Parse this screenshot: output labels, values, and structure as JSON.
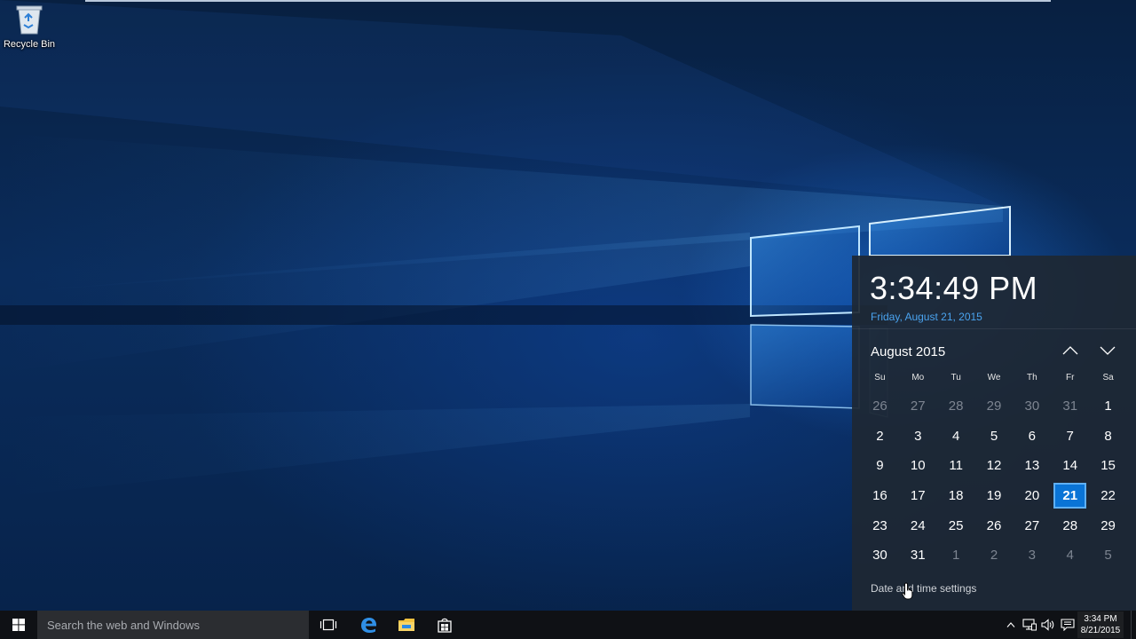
{
  "desktop": {
    "icons": [
      {
        "label": "Recycle Bin"
      }
    ]
  },
  "calendar_flyout": {
    "time": "3:34:49 PM",
    "full_date": "Friday, August 21, 2015",
    "month_title": "August 2015",
    "weekdays": [
      "Su",
      "Mo",
      "Tu",
      "We",
      "Th",
      "Fr",
      "Sa"
    ],
    "days": [
      {
        "d": "26",
        "current": false
      },
      {
        "d": "27",
        "current": false
      },
      {
        "d": "28",
        "current": false
      },
      {
        "d": "29",
        "current": false
      },
      {
        "d": "30",
        "current": false
      },
      {
        "d": "31",
        "current": false
      },
      {
        "d": "1",
        "current": true
      },
      {
        "d": "2",
        "current": true
      },
      {
        "d": "3",
        "current": true
      },
      {
        "d": "4",
        "current": true
      },
      {
        "d": "5",
        "current": true
      },
      {
        "d": "6",
        "current": true
      },
      {
        "d": "7",
        "current": true
      },
      {
        "d": "8",
        "current": true
      },
      {
        "d": "9",
        "current": true
      },
      {
        "d": "10",
        "current": true
      },
      {
        "d": "11",
        "current": true
      },
      {
        "d": "12",
        "current": true
      },
      {
        "d": "13",
        "current": true
      },
      {
        "d": "14",
        "current": true
      },
      {
        "d": "15",
        "current": true
      },
      {
        "d": "16",
        "current": true
      },
      {
        "d": "17",
        "current": true
      },
      {
        "d": "18",
        "current": true
      },
      {
        "d": "19",
        "current": true
      },
      {
        "d": "20",
        "current": true
      },
      {
        "d": "21",
        "current": true,
        "today": true
      },
      {
        "d": "22",
        "current": true
      },
      {
        "d": "23",
        "current": true
      },
      {
        "d": "24",
        "current": true
      },
      {
        "d": "25",
        "current": true
      },
      {
        "d": "26",
        "current": true
      },
      {
        "d": "27",
        "current": true
      },
      {
        "d": "28",
        "current": true
      },
      {
        "d": "29",
        "current": true
      },
      {
        "d": "30",
        "current": true
      },
      {
        "d": "31",
        "current": true
      },
      {
        "d": "1",
        "current": false
      },
      {
        "d": "2",
        "current": false
      },
      {
        "d": "3",
        "current": false
      },
      {
        "d": "4",
        "current": false
      },
      {
        "d": "5",
        "current": false
      }
    ],
    "settings_link": "Date and time settings",
    "colors": {
      "accent": "#0a74d6",
      "date_text": "#4aa3ef"
    }
  },
  "taskbar": {
    "search_placeholder": "Search the web and Windows",
    "pinned": [
      "task-view-icon",
      "edge-icon",
      "file-explorer-icon",
      "store-icon"
    ],
    "tray": {
      "icons": [
        "chevron-up-icon",
        "network-icon",
        "volume-icon",
        "action-center-icon"
      ],
      "time": "3:34 PM",
      "date": "8/21/2015"
    }
  }
}
